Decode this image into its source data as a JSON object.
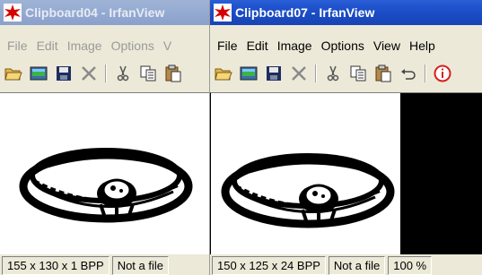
{
  "window_left": {
    "title": "Clipboard04 - IrfanView",
    "menu": [
      "File",
      "Edit",
      "Image",
      "Options",
      "V"
    ],
    "status": [
      "155 x 130 x 1 BPP",
      "Not a file"
    ]
  },
  "window_right": {
    "title": "Clipboard07 - IrfanView",
    "menu": [
      "File",
      "Edit",
      "Image",
      "Options",
      "View",
      "Help"
    ],
    "status": [
      "150 x 125 x 24 BPP",
      "Not a file",
      "100 %"
    ]
  },
  "toolbar_icons": [
    "open-folder-icon",
    "slideshow-icon",
    "save-icon",
    "delete-icon",
    "cut-icon",
    "copy-icon",
    "paste-icon",
    "undo-icon",
    "info-icon"
  ],
  "colors": {
    "active_title": "#1c4fc9",
    "inactive_title": "#9fb3d6",
    "info_red": "#d82020"
  }
}
